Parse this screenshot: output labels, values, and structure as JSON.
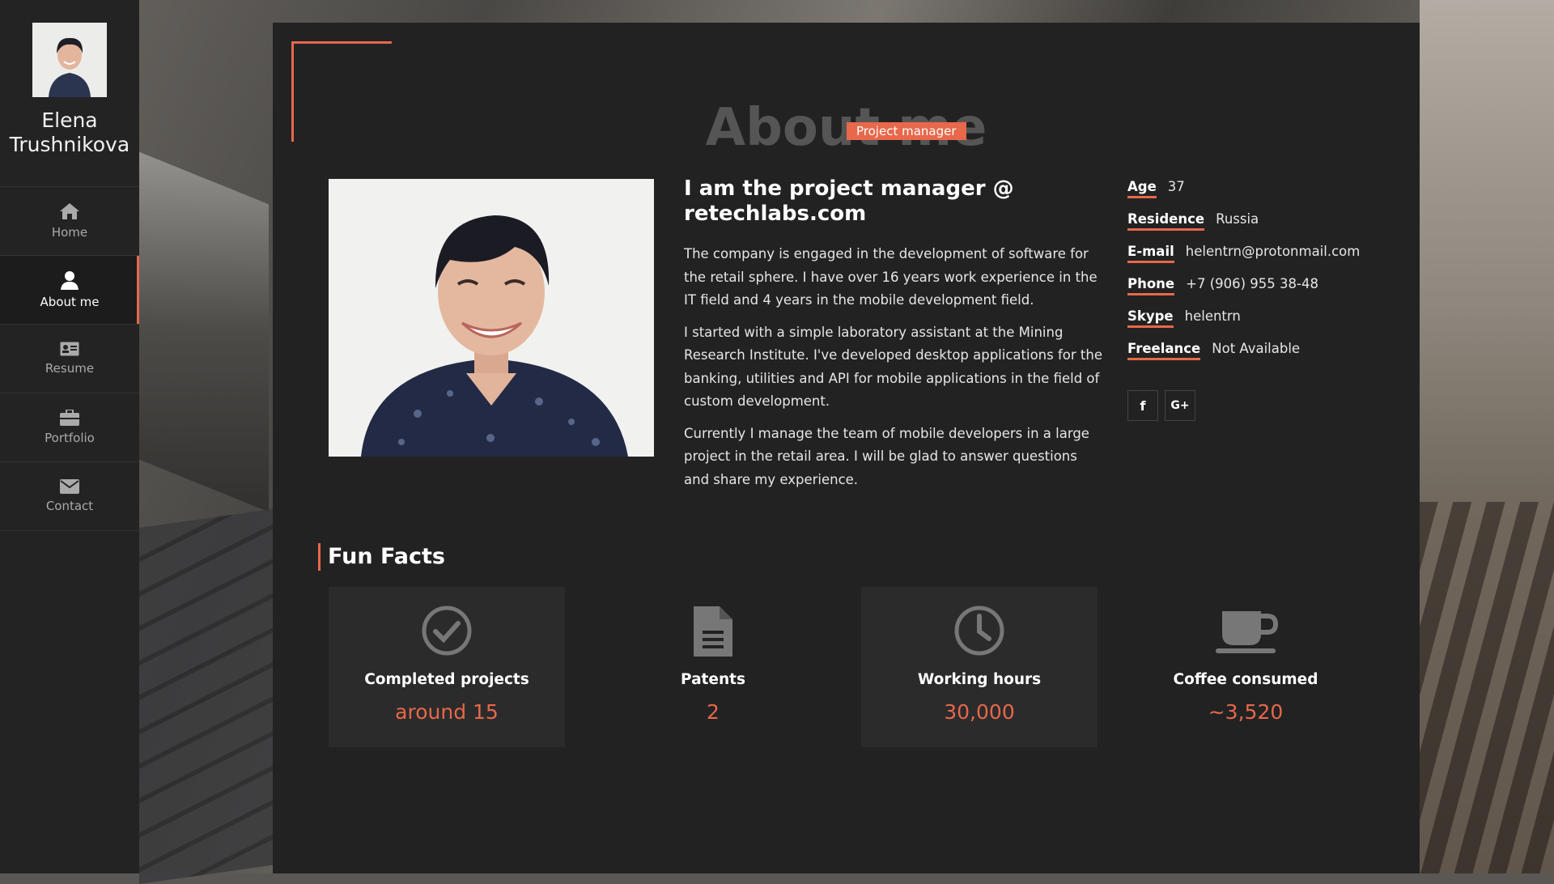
{
  "profile": {
    "first_name": "Elena",
    "last_name": "Trushnikova"
  },
  "nav": {
    "items": [
      {
        "label": "Home",
        "icon": "home-icon"
      },
      {
        "label": "About me",
        "icon": "user-icon",
        "active": true
      },
      {
        "label": "Resume",
        "icon": "id-card-icon"
      },
      {
        "label": "Portfolio",
        "icon": "briefcase-icon"
      },
      {
        "label": "Contact",
        "icon": "envelope-icon"
      }
    ]
  },
  "header": {
    "title": "About me",
    "role_badge": "Project manager"
  },
  "bio": {
    "heading": "I am the project manager @ retechlabs.com",
    "paragraphs": [
      "The company is engaged in the development of software for the retail sphere. I have over 16 years work experience in the IT field and 4 years in the mobile development field.",
      "I started with a simple laboratory assistant at the Mining Research Institute. I've developed desktop applications for the banking, utilities and API for mobile applications in the field of custom development.",
      "Currently I manage the team of mobile developers in a large project in the retail area. I will be glad to answer questions and share my experience."
    ]
  },
  "info": [
    {
      "key": "Age",
      "value": "37"
    },
    {
      "key": "Residence",
      "value": "Russia"
    },
    {
      "key": "E-mail",
      "value": "helentrn@protonmail.com"
    },
    {
      "key": "Phone",
      "value": "+7 (906) 955 38-48"
    },
    {
      "key": "Skype",
      "value": "helentrn"
    },
    {
      "key": "Freelance",
      "value": "Not Available"
    }
  ],
  "social": [
    {
      "label": "f",
      "icon": "facebook-icon"
    },
    {
      "label": "G+",
      "icon": "google-plus-icon"
    }
  ],
  "fun_facts": {
    "title": "Fun Facts",
    "items": [
      {
        "title": "Completed projects",
        "value": "around 15",
        "icon": "check-circle-icon"
      },
      {
        "title": "Patents",
        "value": "2",
        "icon": "document-icon"
      },
      {
        "title": "Working hours",
        "value": "30,000",
        "icon": "clock-icon"
      },
      {
        "title": "Coffee consumed",
        "value": "~3,520",
        "icon": "coffee-cup-icon"
      }
    ]
  },
  "colors": {
    "accent": "#e7684b",
    "sidebar_bg": "#232324",
    "card_bg": "#222223"
  }
}
